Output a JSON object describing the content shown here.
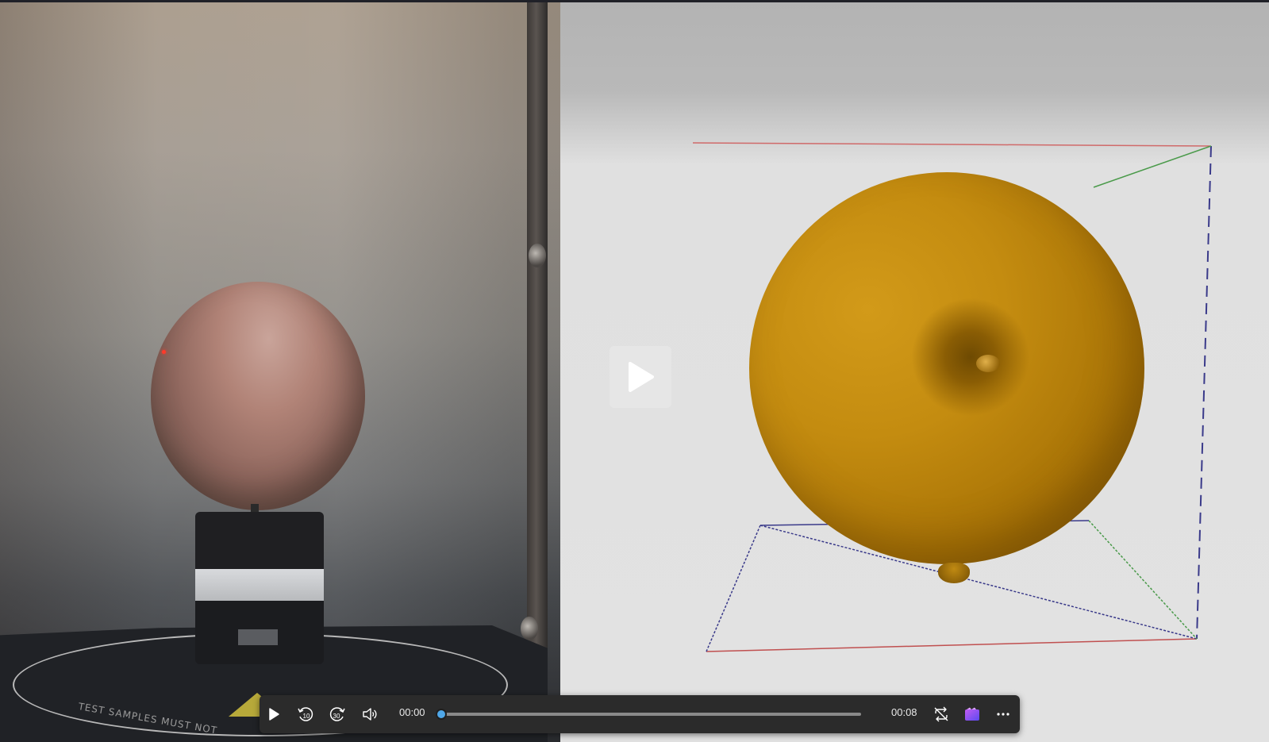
{
  "player": {
    "current_time": "00:00",
    "duration": "00:08",
    "progress": 0.0
  },
  "scene": {
    "floor_warning_text": "TEST SAMPLES MUST NOT"
  },
  "icons": {
    "play": "play-icon",
    "skip_back": "skip-back-10-icon",
    "skip_forward": "skip-forward-30-icon",
    "volume": "volume-icon",
    "repeat": "repeat-icon",
    "app": "clipchamp-icon",
    "more": "more-icon"
  },
  "colors": {
    "progress_accent": "#4fa7e8",
    "model_color": "#c48c10"
  }
}
